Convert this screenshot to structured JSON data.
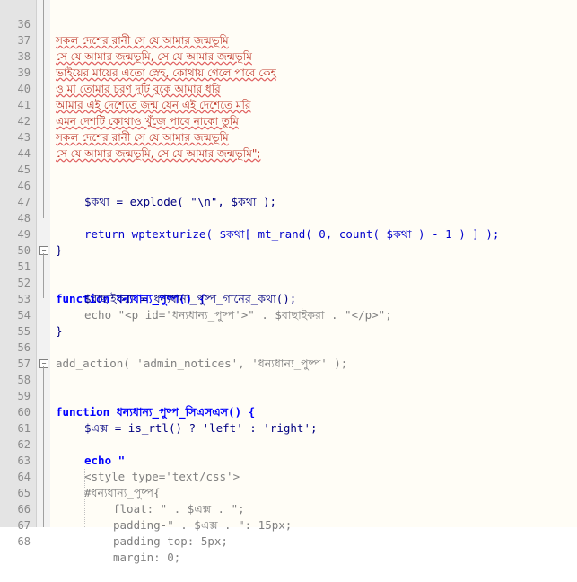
{
  "lines": [
    {
      "n": "36",
      "text": "সকল দেশের রানী সে যে আমার জন্মভূমি"
    },
    {
      "n": "37",
      "text": "সে যে আমার জন্মভূমি, সে যে আমার জন্মভূমি"
    },
    {
      "n": "38",
      "text": "ভাইয়ের মায়ের এতো স্নেহ, কোথায় গেলে পাবে কেহ"
    },
    {
      "n": "39",
      "text": "ও মা তোমার চরণ দুটি বুকে আমার ধরি"
    },
    {
      "n": "40",
      "text": "আমার এই দেশেতে জন্ম যেন এই দেশেতে মরি"
    },
    {
      "n": "41",
      "text": "এমন দেশটি কোথাও খুঁজে পাবে নাকো তুমি"
    },
    {
      "n": "42",
      "text": "সকল দেশের রানী সে যে আমার জন্মভূমি"
    },
    {
      "n": "43",
      "text": "সে যে আমার জন্মভূমি, সে যে আমার জন্মভূমি\";"
    },
    {
      "n": "44",
      "text": ""
    },
    {
      "n": "45",
      "text": ""
    },
    {
      "n": "46",
      "text": "$কথা = explode( \"\\n\", $কথা );"
    },
    {
      "n": "47",
      "text": ""
    },
    {
      "n": "48",
      "text": "return wptexturize( $কথা[ mt_rand( 0, count( $কথা ) - 1 ) ] );"
    },
    {
      "n": "49",
      "text": "}"
    },
    {
      "n": "50",
      "text": ""
    },
    {
      "n": "51",
      "text": "function ধন্যধান্য_পুষ্প() {"
    },
    {
      "n": "52",
      "text": "$বাছাইকরা = ধন্যধান্য_পুষ্প_গানের_কথা();"
    },
    {
      "n": "53",
      "text": "echo \"<p id='ধন্যধান্য_পুষ্প'>\" . $বাছাইকরা . \"</p>\";"
    },
    {
      "n": "54",
      "text": "}"
    },
    {
      "n": "55",
      "text": ""
    },
    {
      "n": "56",
      "text": "add_action( 'admin_notices', 'ধন্যধান্য_পুষ্প' );"
    },
    {
      "n": "57",
      "text": ""
    },
    {
      "n": "58",
      "text": "function ধন্যধান্য_পুষ্প_সিএসএস() {"
    },
    {
      "n": "59",
      "text": ""
    },
    {
      "n": "60",
      "text": "$এক্স = is_rtl() ? 'left' : 'right';"
    },
    {
      "n": "61",
      "text": ""
    },
    {
      "n": "62",
      "text": "echo \""
    },
    {
      "n": "63",
      "text": "<style type='text/css'>"
    },
    {
      "n": "64",
      "text": "#ধন্যধান্য_পুষ্প{"
    },
    {
      "n": "65",
      "text": "float: \" . $এক্স . \";"
    },
    {
      "n": "66",
      "text": "padding-\" . $এক্স . \": 15px;"
    },
    {
      "n": "67",
      "text": "padding-top: 5px;"
    },
    {
      "n": "68",
      "text": "margin: 0;"
    }
  ],
  "colors": {
    "keyword": "#0000ff",
    "string": "#808080",
    "number": "#ff8000",
    "bengali": "#c0392b"
  }
}
